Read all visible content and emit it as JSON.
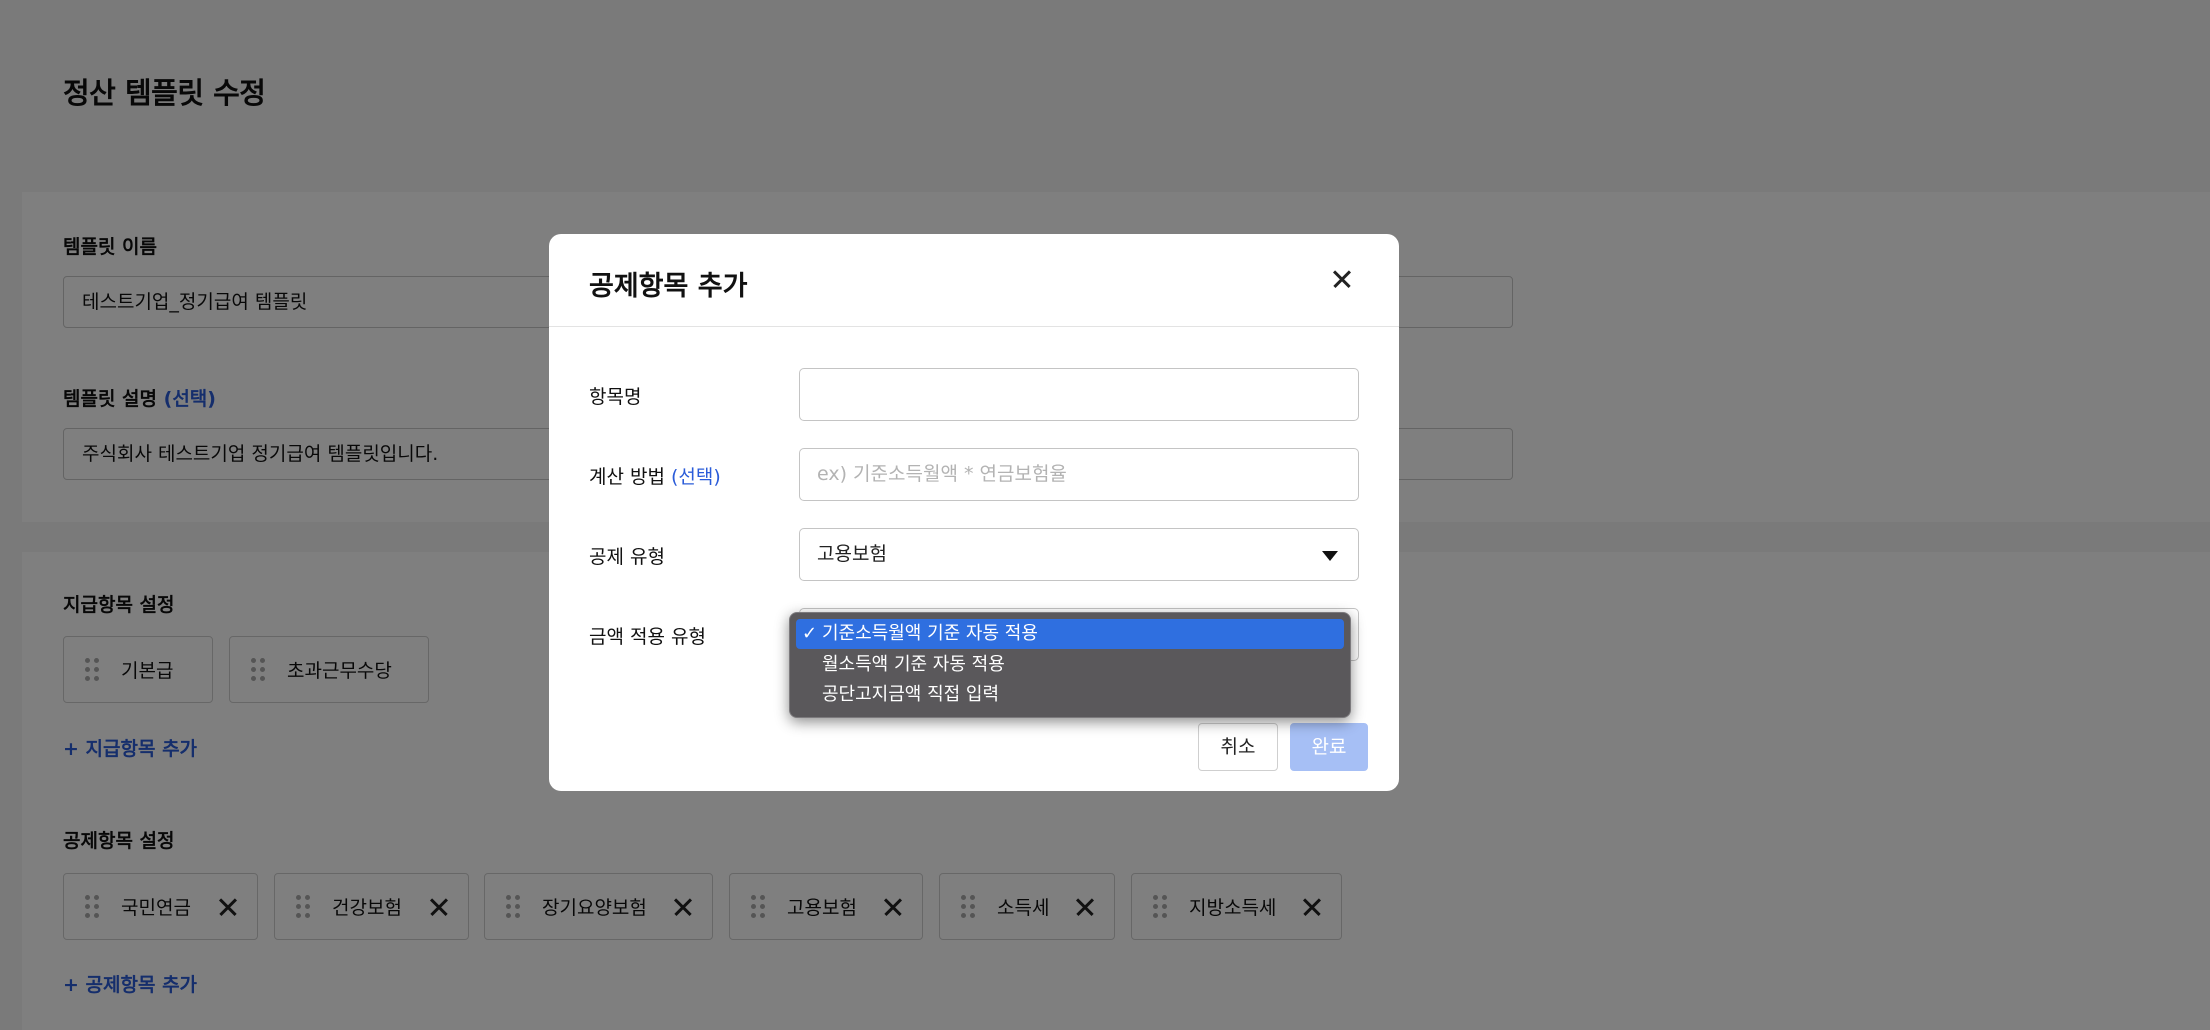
{
  "page": {
    "title": "정산 템플릿 수정",
    "template_name": {
      "label": "템플릿 이름",
      "value": "테스트기업_정기급여 템플릿"
    },
    "template_desc": {
      "label": "템플릿 설명",
      "optional": "(선택)",
      "value": "주식회사 테스트기업 정기급여 템플릿입니다."
    },
    "payment": {
      "label": "지급항목 설정",
      "items": [
        "기본급",
        "초과근무수당"
      ],
      "add_label": "+ 지급항목 추가"
    },
    "deduction": {
      "label": "공제항목 설정",
      "items": [
        "국민연금",
        "건강보험",
        "장기요양보험",
        "고용보험",
        "소득세",
        "지방소득세"
      ],
      "add_label": "+ 공제항목 추가"
    }
  },
  "modal": {
    "title": "공제항목 추가",
    "item_name": {
      "label": "항목명",
      "value": ""
    },
    "calc_method": {
      "label": "계산 방법",
      "optional": "(선택)",
      "placeholder": "ex) 기준소득월액 * 연금보험율"
    },
    "deduction_type": {
      "label": "공제 유형",
      "value": "고용보험"
    },
    "amount_type": {
      "label": "금액 적용 유형",
      "options": [
        "기준소득월액 기준 자동 적용",
        "월소득액 기준 자동 적용",
        "공단고지금액 직접 입력"
      ],
      "selected_mark": "✓"
    },
    "cancel_label": "취소",
    "done_label": "완료"
  },
  "colors": {
    "accent": "#2b5cd9",
    "disabled_primary": "#a6bff5",
    "selected_option": "#2f6fe0"
  }
}
